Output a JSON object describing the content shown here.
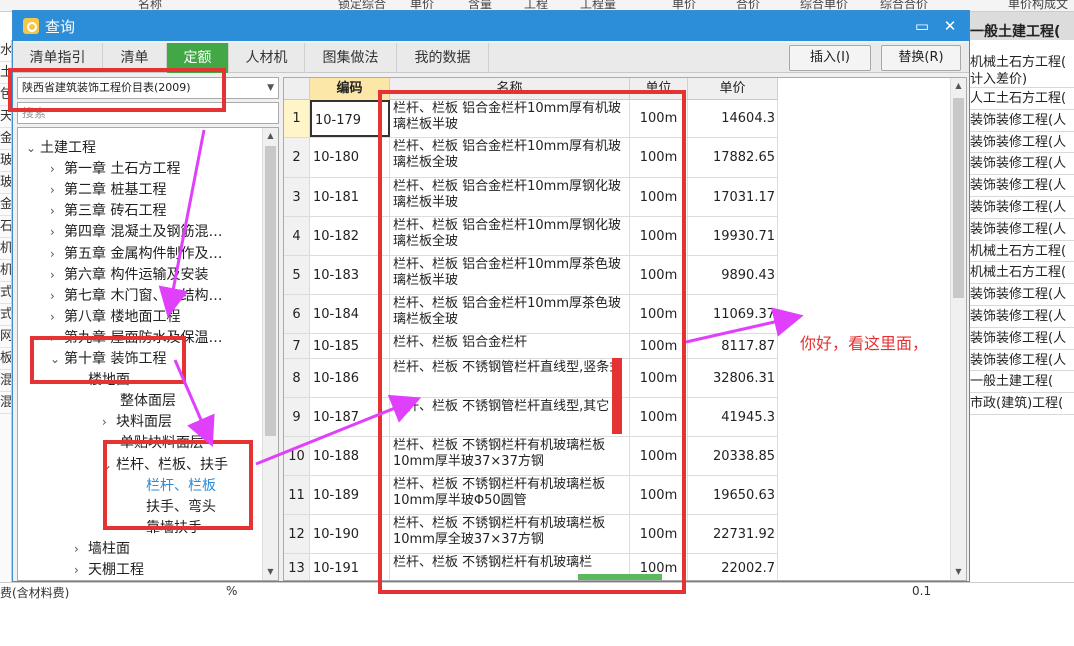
{
  "background": {
    "top_headers": [
      "名称",
      "锁定综合",
      "单价",
      "含量",
      "工程",
      "工程量",
      "单价",
      "合价",
      "综合单价",
      "综合合价",
      "单价构成文"
    ],
    "left_chars": [
      "水",
      "土",
      "包",
      "天",
      "金",
      "玻",
      "玻",
      "金",
      "石",
      "机",
      "机",
      "式",
      "式",
      "网",
      "板",
      "混",
      "混"
    ],
    "right_header": "一般土建工程(",
    "right_row2_lines": [
      "机械土石方工程(",
      "计入差价)"
    ],
    "right_rows": [
      "人工土石方工程(",
      "装饰装修工程(人",
      "装饰装修工程(人",
      "装饰装修工程(人",
      "装饰装修工程(人",
      "装饰装修工程(人",
      "装饰装修工程(人",
      "机械土石方工程(",
      "机械土石方工程(",
      "装饰装修工程(人",
      "装饰装修工程(人",
      "装饰装修工程(人",
      "装饰装修工程(人",
      "一般土建工程(",
      "市政(建筑)工程("
    ],
    "bottom_text": "费(含材料费)",
    "bottom_unit": "%",
    "bottom_value": "0.1"
  },
  "dialog": {
    "title": "查询",
    "tabs": [
      "清单指引",
      "清单",
      "定额",
      "人材机",
      "图集做法",
      "我的数据"
    ],
    "active_tab": "定额",
    "insert_button": "插入(I)",
    "replace_button": "替换(R)",
    "library": "陕西省建筑装饰工程价目表(2009)",
    "search_placeholder": "搜索"
  },
  "tree": [
    {
      "label": "土建工程",
      "chev": "expanded"
    },
    {
      "label": "第一章  土石方工程",
      "chev": "collapsed"
    },
    {
      "label": "第二章  桩基工程",
      "chev": "collapsed"
    },
    {
      "label": "第三章  砖石工程",
      "chev": "collapsed"
    },
    {
      "label": "第四章  混凝土及钢筋混…",
      "chev": "collapsed"
    },
    {
      "label": "第五章  金属构件制作及…",
      "chev": "collapsed"
    },
    {
      "label": "第六章  构件运输及安装",
      "chev": "collapsed"
    },
    {
      "label": "第七章  木门窗、木结构…",
      "chev": "collapsed"
    },
    {
      "label": "第八章  楼地面工程",
      "chev": "collapsed"
    },
    {
      "label": "第九章  屋面防水及保温…",
      "chev": "collapsed"
    },
    {
      "label": "第十章  装饰工程",
      "chev": "expanded"
    },
    {
      "label": "楼地面",
      "chev": "expanded"
    },
    {
      "label": "整体面层",
      "chev": "none"
    },
    {
      "label": "块料面层",
      "chev": "collapsed"
    },
    {
      "label": "单贴块料面层",
      "chev": "none"
    },
    {
      "label": "栏杆、栏板、扶手",
      "chev": "expanded"
    },
    {
      "label": "栏杆、栏板",
      "chev": "none",
      "selected": true
    },
    {
      "label": "扶手、弯头",
      "chev": "none"
    },
    {
      "label": "靠墙扶手",
      "chev": "none"
    },
    {
      "label": "墙柱面",
      "chev": "collapsed"
    },
    {
      "label": "天棚工程",
      "chev": "collapsed"
    },
    {
      "label": "门窗工程",
      "chev": "collapsed"
    }
  ],
  "grid": {
    "headers": {
      "code": "编码",
      "name": "名称",
      "unit": "单位",
      "price": "单价"
    },
    "rows": [
      {
        "idx": "1",
        "code": "10-179",
        "name": "栏杆、栏板 铝合金栏杆10mm厚有机玻璃栏板半玻",
        "unit": "100m",
        "price": "14604.3"
      },
      {
        "idx": "2",
        "code": "10-180",
        "name": "栏杆、栏板 铝合金栏杆10mm厚有机玻璃栏板全玻",
        "unit": "100m",
        "price": "17882.65"
      },
      {
        "idx": "3",
        "code": "10-181",
        "name": "栏杆、栏板 铝合金栏杆10mm厚钢化玻璃栏板半玻",
        "unit": "100m",
        "price": "17031.17"
      },
      {
        "idx": "4",
        "code": "10-182",
        "name": "栏杆、栏板 铝合金栏杆10mm厚钢化玻璃栏板全玻",
        "unit": "100m",
        "price": "19930.71"
      },
      {
        "idx": "5",
        "code": "10-183",
        "name": "栏杆、栏板 铝合金栏杆10mm厚茶色玻璃栏板半玻",
        "unit": "100m",
        "price": "9890.43"
      },
      {
        "idx": "6",
        "code": "10-184",
        "name": "栏杆、栏板 铝合金栏杆10mm厚茶色玻璃栏板全玻",
        "unit": "100m",
        "price": "11069.37"
      },
      {
        "idx": "7",
        "code": "10-185",
        "name": "栏杆、栏板 铝合金栏杆",
        "unit": "100m",
        "price": "8117.87"
      },
      {
        "idx": "8",
        "code": "10-186",
        "name": "栏杆、栏板 不锈钢管栏杆直线型,竖条式",
        "unit": "100m",
        "price": "32806.31"
      },
      {
        "idx": "9",
        "code": "10-187",
        "name": "栏杆、栏板 不锈钢管栏杆直线型,其它",
        "unit": "100m",
        "price": "41945.3"
      },
      {
        "idx": "10",
        "code": "10-188",
        "name": "栏杆、栏板 不锈钢栏杆有机玻璃栏板10mm厚半玻37×37方钢",
        "unit": "100m",
        "price": "20338.85"
      },
      {
        "idx": "11",
        "code": "10-189",
        "name": "栏杆、栏板 不锈钢栏杆有机玻璃栏板10mm厚半玻Φ50圆管",
        "unit": "100m",
        "price": "19650.63"
      },
      {
        "idx": "12",
        "code": "10-190",
        "name": "栏杆、栏板 不锈钢栏杆有机玻璃栏板10mm厚全玻37×37方钢",
        "unit": "100m",
        "price": "22731.92"
      },
      {
        "idx": "13",
        "code": "10-191",
        "name": "栏杆、栏板 不锈钢栏杆有机玻璃栏",
        "unit": "100m",
        "price": "22002.7"
      }
    ]
  },
  "annotation": {
    "note": "你好，看这里面，",
    "color": "#e53333",
    "arrow_color": "#e040fb"
  },
  "colors": {
    "titlebar": "#2c8ed8",
    "active_tab": "#41a845",
    "code_header": "#fce6a8",
    "selected_tree_item": "#2d8cd8"
  }
}
